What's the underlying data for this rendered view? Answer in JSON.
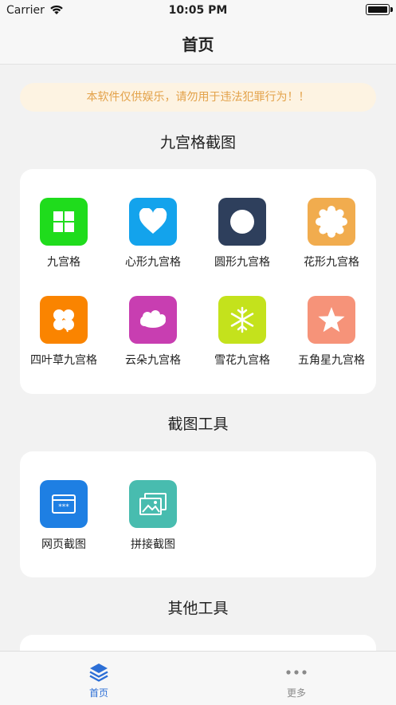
{
  "status_bar": {
    "carrier": "Carrier",
    "time": "10:05 PM"
  },
  "nav": {
    "title": "首页"
  },
  "notice": "本软件仅供娱乐，请勿用于违法犯罪行为！！",
  "sections": {
    "grid": {
      "title": "九宫格截图",
      "items": [
        {
          "label": "九宫格",
          "icon": "grid-icon",
          "color": "#1fdc1c"
        },
        {
          "label": "心形九宫格",
          "icon": "heart-icon",
          "color": "#13a3ec"
        },
        {
          "label": "圆形九宫格",
          "icon": "circle-icon",
          "color": "#2e3f5c"
        },
        {
          "label": "花形九宫格",
          "icon": "flower-icon",
          "color": "#f1ac4e"
        },
        {
          "label": "四叶草九宫格",
          "icon": "clover-icon",
          "color": "#fa8400"
        },
        {
          "label": "云朵九宫格",
          "icon": "cloud-icon",
          "color": "#c83eb1"
        },
        {
          "label": "雪花九宫格",
          "icon": "snowflake-icon",
          "color": "#c4e21c"
        },
        {
          "label": "五角星九宫格",
          "icon": "star-icon",
          "color": "#f69379"
        }
      ]
    },
    "tools": {
      "title": "截图工具",
      "items": [
        {
          "label": "网页截图",
          "icon": "webpage-icon",
          "color": "#1e7fe3"
        },
        {
          "label": "拼接截图",
          "icon": "image-stitch-icon",
          "color": "#48bcaf"
        }
      ]
    },
    "other": {
      "title": "其他工具"
    }
  },
  "tabs": [
    {
      "label": "首页",
      "icon": "layers-icon",
      "active": true,
      "color": "#2d6fd6"
    },
    {
      "label": "更多",
      "icon": "more-icon",
      "active": false,
      "color": "#8a8a8a"
    }
  ]
}
